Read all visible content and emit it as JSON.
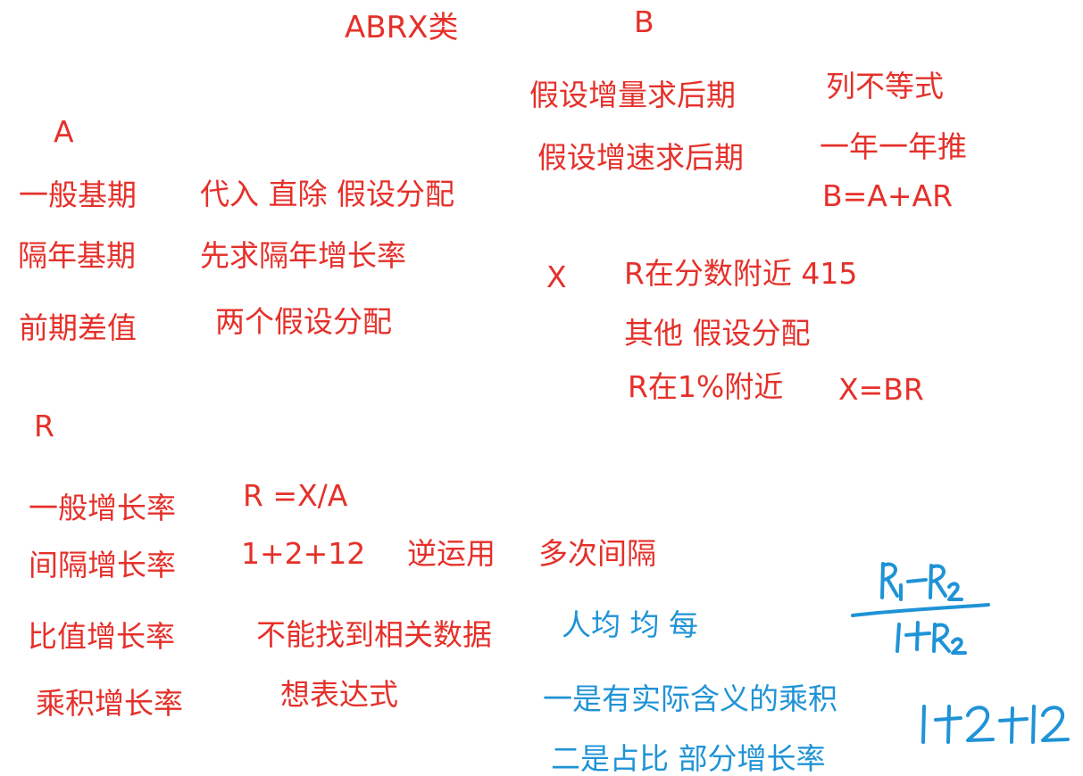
{
  "title": "ABRX类",
  "b": {
    "heading": "B",
    "rows": [
      {
        "label": "假设增量求后期",
        "method": "列不等式"
      },
      {
        "label": "假设增速求后期",
        "method": "一年一年推"
      }
    ],
    "formula": "B=A+AR"
  },
  "a": {
    "heading": "A",
    "rows": [
      {
        "label": "一般基期",
        "method": "代入 直除 假设分配"
      },
      {
        "label": "隔年基期",
        "method": "先求隔年增长率"
      },
      {
        "label": "前期差值",
        "method": "两个假设分配"
      }
    ]
  },
  "x": {
    "heading": "X",
    "lines": [
      "R在分数附近 415",
      "其他 假设分配",
      "R在1%附近"
    ],
    "formula": "X=BR"
  },
  "r": {
    "heading": "R",
    "rows": [
      {
        "label": "一般增长率",
        "method": "R =X/A"
      },
      {
        "label": "间隔增长率",
        "method": "1+2+12",
        "extra1": "逆运用",
        "extra2": "多次间隔"
      },
      {
        "label": "比值增长率",
        "method": "不能找到相关数据",
        "note": "人均 均 每"
      },
      {
        "label": "乘积增长率",
        "method": "想表达式",
        "note": "一是有实际含义的乘积"
      }
    ],
    "note_last": "二是占比 部分增长率"
  },
  "colors": {
    "red": "#e5302a",
    "blue": "#1f93d6"
  }
}
